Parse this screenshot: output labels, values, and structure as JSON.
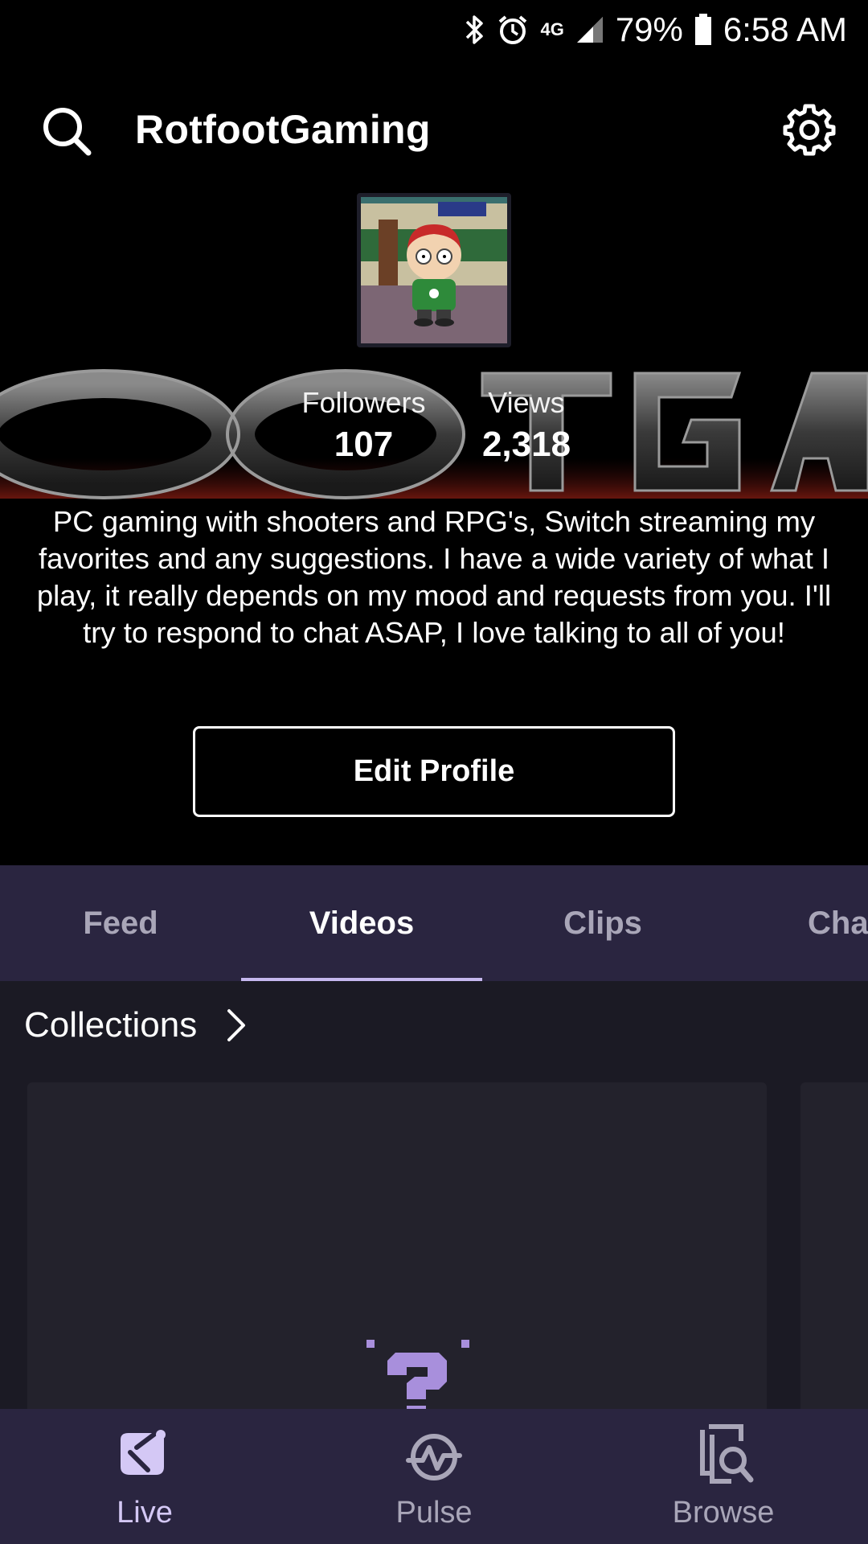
{
  "status_bar": {
    "network": "4G",
    "battery": "79%",
    "time": "6:58 AM"
  },
  "header": {
    "title": "RotfootGaming"
  },
  "profile": {
    "stats": {
      "followers_label": "Followers",
      "followers_value": "107",
      "views_label": "Views",
      "views_value": "2,318"
    },
    "bio": "PC gaming with shooters and RPG's, Switch streaming my favorites and any suggestions.  I have a wide variety of what I play, it really depends on my mood and requests from you.  I'll try to respond to chat ASAP, I love talking to all of you!",
    "edit_button": "Edit Profile"
  },
  "tabs": [
    {
      "label": "Feed",
      "active": false
    },
    {
      "label": "Videos",
      "active": true
    },
    {
      "label": "Clips",
      "active": false
    },
    {
      "label": "Cha",
      "active": false
    }
  ],
  "content": {
    "collections_title": "Collections"
  },
  "bottom_nav": [
    {
      "label": "Live",
      "icon": "live-icon",
      "active": true
    },
    {
      "label": "Pulse",
      "icon": "pulse-icon",
      "active": false
    },
    {
      "label": "Browse",
      "icon": "browse-icon",
      "active": false
    }
  ],
  "colors": {
    "background": "#000000",
    "tab_bar": "#2a2540",
    "accent": "#c6b8ef",
    "content_bg": "#1b1a24",
    "empty_icon": "#a88fdc"
  }
}
